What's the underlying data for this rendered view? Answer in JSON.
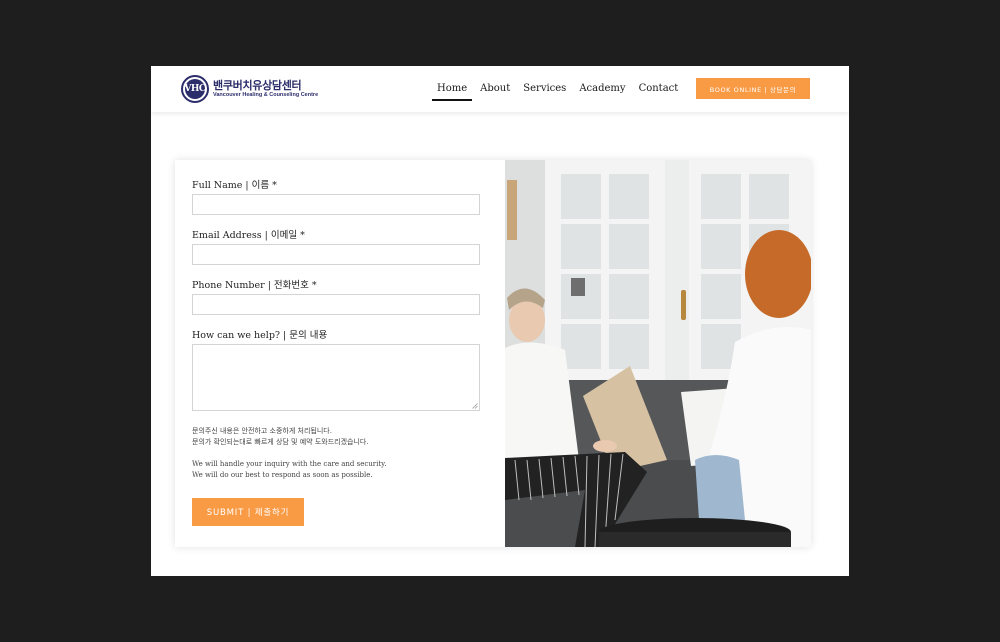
{
  "header": {
    "logo": {
      "mark_text": "VHC",
      "name_kr": "밴쿠버치유상담센터",
      "name_en": "Vancouver Healing & Counseling Centre"
    },
    "nav": [
      {
        "label": "Home",
        "active": true
      },
      {
        "label": "About",
        "active": false
      },
      {
        "label": "Services",
        "active": false
      },
      {
        "label": "Academy",
        "active": false
      },
      {
        "label": "Contact",
        "active": false
      }
    ],
    "book_button": "BOOK ONLINE | 상담문의"
  },
  "form": {
    "full_name_label": "Full Name | 이름 *",
    "full_name_value": "",
    "email_label": "Email Address | 이메일 *",
    "email_value": "",
    "phone_label": "Phone Number | 전화번호 *",
    "phone_value": "",
    "message_label": "How can we help? | 문의 내용",
    "message_value": "",
    "note_kr_1": "문의주신 내용은 안전하고 소중하게 처리됩니다.",
    "note_kr_2": "문의가 확인되는대로 빠르게 상담 및 예약 도와드리겠습니다.",
    "note_en_1": "We will handle your inquiry with the care and security.",
    "note_en_2": "We will do our best to respond as soon as possible.",
    "submit_label": "SUBMIT | 제출하기"
  },
  "colors": {
    "accent": "#f99a45",
    "brand": "#2c2d6b",
    "backdrop": "#1e1e1e"
  }
}
